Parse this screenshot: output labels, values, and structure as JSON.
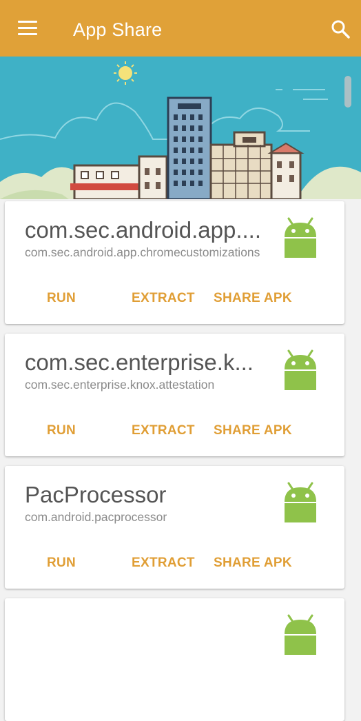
{
  "appbar": {
    "title": "App Share",
    "menu_icon": "menu-icon",
    "search_icon": "search-icon",
    "color": "#e0a138"
  },
  "apps": [
    {
      "name": "com.sec.android.app....",
      "package": "com.sec.android.app.chromecustomizations",
      "icon": "android-icon",
      "actions": {
        "run": "RUN",
        "extract": "EXTRACT",
        "share": "SHARE APK"
      }
    },
    {
      "name": "com.sec.enterprise.k...",
      "package": "com.sec.enterprise.knox.attestation",
      "icon": "android-icon",
      "actions": {
        "run": "RUN",
        "extract": "EXTRACT",
        "share": "SHARE APK"
      }
    },
    {
      "name": "PacProcessor",
      "package": "com.android.pacprocessor",
      "icon": "android-icon",
      "actions": {
        "run": "RUN",
        "extract": "EXTRACT",
        "share": "SHARE APK"
      }
    }
  ],
  "colors": {
    "accent": "#e09e35",
    "android_green": "#8fc24a",
    "sky": "#3fb1c6"
  }
}
